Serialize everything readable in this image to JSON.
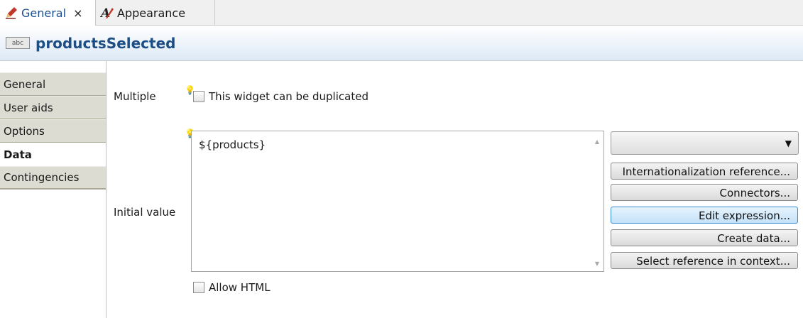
{
  "tabs": [
    {
      "label": "General",
      "close": "×"
    },
    {
      "label": "Appearance"
    }
  ],
  "header": {
    "icon_text": "abc",
    "title": "productsSelected"
  },
  "nav": {
    "items": [
      {
        "label": "General"
      },
      {
        "label": "User aids"
      },
      {
        "label": "Options"
      },
      {
        "label": "Data"
      },
      {
        "label": "Contingencies"
      }
    ]
  },
  "form": {
    "multiple_label": "Multiple",
    "duplicate_checkbox_label": "This widget can be duplicated",
    "initial_value_label": "Initial value",
    "initial_value_text": "${products}",
    "allow_html_label": "Allow HTML"
  },
  "buttons": {
    "internationalization": "Internationalization reference...",
    "connectors": "Connectors...",
    "edit_expression": "Edit expression...",
    "create_data": "Create data...",
    "select_reference": "Select reference in context..."
  },
  "colors": {
    "title": "#1d4f85",
    "focus_button": "#3a8ad6",
    "tab_active_text": "#1f4e8c"
  }
}
